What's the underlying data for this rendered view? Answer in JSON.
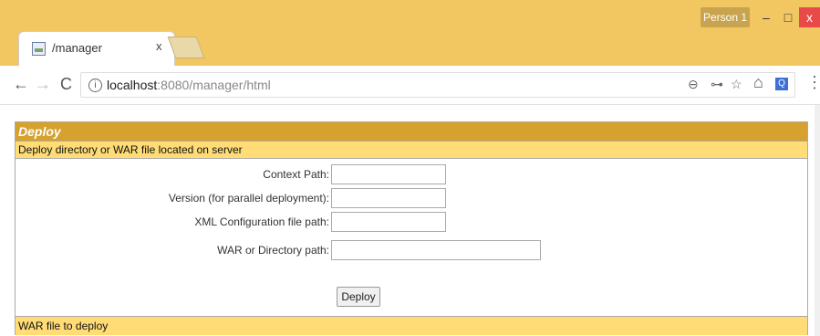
{
  "window": {
    "profile_name": "Person 1",
    "minimize_glyph": "–",
    "maximize_glyph": "□",
    "close_glyph": "x"
  },
  "tab": {
    "title": "/manager",
    "close_glyph": "x"
  },
  "toolbar": {
    "back_glyph": "←",
    "forward_glyph": "→",
    "reload_glyph": "C",
    "url_host": "localhost",
    "url_rest": ":8080/manager/html",
    "zoom_glyph": "⊖",
    "key_glyph": "⊶",
    "star_glyph": "☆",
    "home_glyph": "⌂",
    "ext_glyph": "Q",
    "menu_glyph": "⋮"
  },
  "deploy": {
    "section_title": "Deploy",
    "subsection_title": "Deploy directory or WAR file located on server",
    "fields": [
      {
        "label": "Context Path:",
        "value": ""
      },
      {
        "label": "Version (for parallel deployment):",
        "value": ""
      },
      {
        "label": "XML Configuration file path:",
        "value": ""
      },
      {
        "label": "WAR or Directory path:",
        "value": ""
      }
    ],
    "button_label": "Deploy",
    "war_section_title": "WAR file to deploy"
  },
  "colors": {
    "browser_frame": "#f2c762",
    "header_main": "#d6a12e",
    "header_sub": "#ffdc75",
    "close_button": "#e84a4a"
  },
  "icons": [
    "info-icon",
    "zoom-icon",
    "key-icon",
    "star-icon",
    "home-icon",
    "extension-icon",
    "menu-icon",
    "favicon-icon"
  ]
}
